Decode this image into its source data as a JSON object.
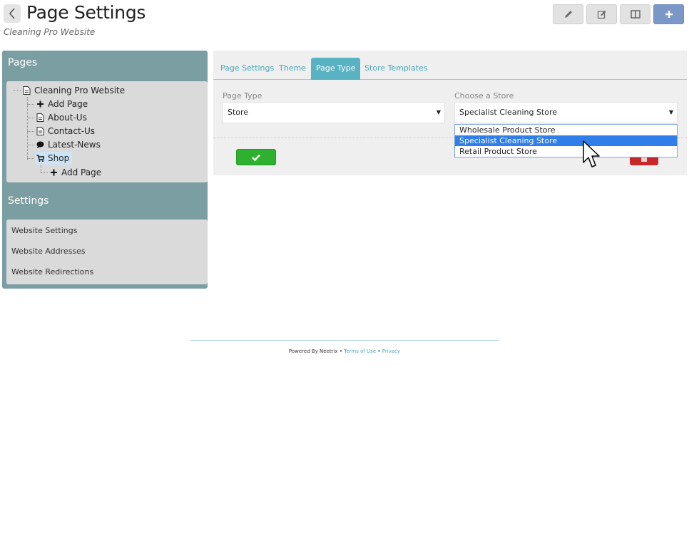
{
  "header": {
    "title": "Page Settings",
    "subtitle": "Cleaning Pro Website",
    "toolbar": [
      {
        "name": "pencil-icon"
      },
      {
        "name": "edit-icon"
      },
      {
        "name": "columns-icon"
      },
      {
        "name": "plus-icon"
      }
    ]
  },
  "sidebar": {
    "pages_heading": "Pages",
    "tree": [
      {
        "label": "Cleaning Pro Website",
        "icon": "document-icon"
      },
      {
        "label": "Add Page",
        "icon": "plus-icon"
      },
      {
        "label": "About-Us",
        "icon": "document-icon"
      },
      {
        "label": "Contact-Us",
        "icon": "document-icon"
      },
      {
        "label": "Latest-News",
        "icon": "comment-icon"
      },
      {
        "label": "Shop",
        "icon": "cart-icon"
      },
      {
        "label": "Add Page",
        "icon": "plus-icon"
      }
    ],
    "settings_heading": "Settings",
    "settings_items": [
      "Website Settings",
      "Website Addresses",
      "Website Redirections"
    ]
  },
  "main": {
    "tabs": [
      "Page Settings",
      "Theme",
      "Page Type",
      "Store Templates"
    ],
    "active_tab": "Page Type",
    "page_type": {
      "label": "Page Type",
      "value": "Store"
    },
    "store": {
      "label": "Choose a Store",
      "value": "Specialist Cleaning Store",
      "options": [
        "Wholesale Product Store",
        "Specialist Cleaning Store",
        "Retail Product Store"
      ],
      "highlighted": "Specialist Cleaning Store"
    }
  },
  "footer": {
    "powered": "Powered By Neetrix",
    "sep": "•",
    "terms": "Terms of Use",
    "privacy": "Privacy"
  },
  "colors": {
    "sidebar_bg": "#7a9ea2",
    "tab_active": "#58b2c2",
    "link": "#4ba6b8",
    "primary_button": "#7b97c7",
    "ok_button": "#2eb12e",
    "delete_button": "#c62828",
    "selected_option": "#2f7ee9"
  }
}
